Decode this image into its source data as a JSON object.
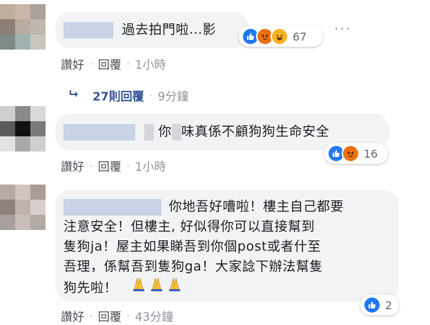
{
  "comments": [
    {
      "text": "過去拍門啦…影",
      "reaction_count": "67",
      "reactions": [
        "like-icon",
        "angry-icon",
        "haha-icon"
      ],
      "actions": {
        "like": "讚好",
        "reply": "回覆",
        "time": "1小時"
      },
      "replies": {
        "label": "27則回覆",
        "time": "9分鐘"
      },
      "more": "···",
      "avatar_colors": [
        "#bfae9c",
        "#c9b6a8",
        "#a8a29a",
        "#8d7f74",
        "#b9aca0",
        "#c2b7ad",
        "#7b8c88",
        "#9fb2b0",
        "#c8c5bd"
      ]
    },
    {
      "text_parts": [
        "你",
        "味真係不顧狗狗生命安全"
      ],
      "reaction_count": "16",
      "reactions": [
        "like-icon",
        "angry-icon"
      ],
      "actions": {
        "like": "讚好",
        "reply": "回覆",
        "time": "1小時"
      },
      "avatar_colors": [
        "#cfcfcf",
        "#8a8a8a",
        "#d9d9d9",
        "#5a5a5a",
        "#111111",
        "#7a7a7a",
        "#e3e3e3",
        "#a9a9a9",
        "#cfcfcf"
      ]
    },
    {
      "lines": [
        "你地吾好嘈啦！樓主自己都要",
        "注意安全！但樓主, 好似得你可以直接幫到",
        "隻狗ja！屋主如果睇吾到你個post或者什至",
        "吾理，係幫吾到隻狗ga！大家諗下辦法幫隻",
        "狗先啦！"
      ],
      "reaction_count": "2",
      "reactions": [
        "like-icon"
      ],
      "actions": {
        "like": "讚好",
        "reply": "回覆",
        "time": "43分鐘"
      },
      "avatar_colors": [
        "#b8a8a6",
        "#d1c4c1",
        "#a89b98",
        "#8f807d",
        "#c0b1ad",
        "#d8cfcc",
        "#a7a09c",
        "#c7bdb9",
        "#b3a9a5"
      ]
    }
  ],
  "colors": {
    "bubble": "#f2f3f5",
    "link": "#365899",
    "like": "#2078f4",
    "angry": "#e9710f",
    "haha": "#f7b125",
    "meta": "#90949c"
  }
}
